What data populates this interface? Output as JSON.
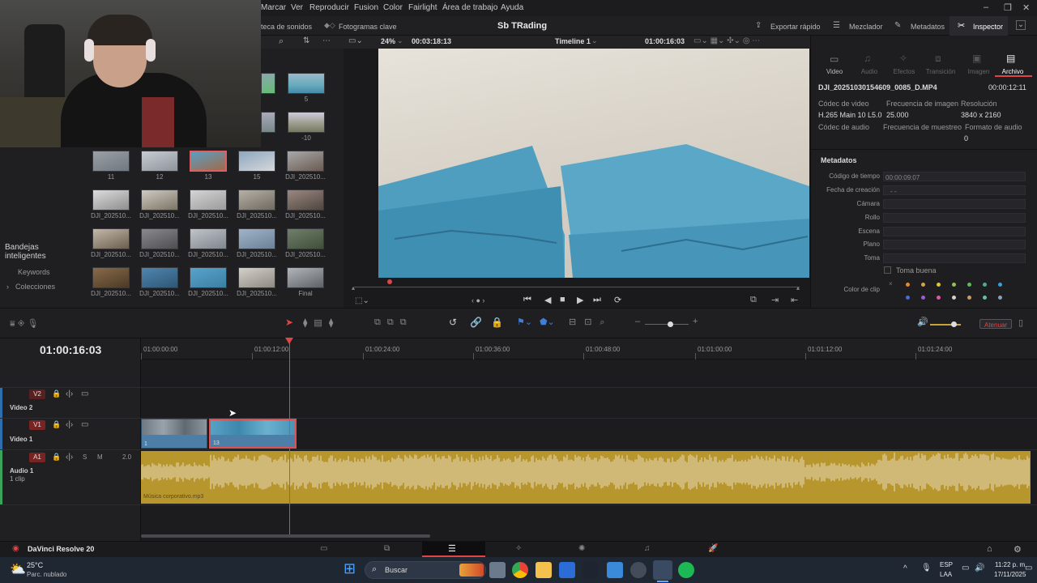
{
  "menubar": {
    "items": [
      "Marcar",
      "Ver",
      "Reproducir",
      "Fusion",
      "Color",
      "Fairlight",
      "Área de trabajo",
      "Ayuda"
    ]
  },
  "toolbar": {
    "sound_library": "teca de sonidos",
    "keyframes": "Fotogramas clave",
    "project_title": "Sb TRading",
    "quick_export": "Exportar rápido",
    "mixer": "Mezclador",
    "metadata": "Metadatos",
    "inspector": "Inspector"
  },
  "viewer": {
    "zoom": "24%",
    "timecode_left": "00:03:18:13",
    "timeline_name": "Timeline 1",
    "timecode_right": "01:00:16:03",
    "clip_number": "13"
  },
  "media_pool": {
    "partial_labels": [
      "5",
      "-10"
    ],
    "rows": [
      [
        "11",
        "12",
        "13",
        "15",
        "DJI_202510..."
      ],
      [
        "DJI_202510...",
        "DJI_202510...",
        "DJI_202510...",
        "DJI_202510...",
        "DJI_202510..."
      ],
      [
        "DJI_202510...",
        "DJI_202510...",
        "DJI_202510...",
        "DJI_202510...",
        "DJI_202510..."
      ],
      [
        "DJI_202510...",
        "DJI_202510...",
        "DJI_202510...",
        "DJI_202510...",
        "Final"
      ]
    ],
    "selected": "13",
    "bins_title": "Bandejas inteligentes",
    "bins_keywords": "Keywords",
    "bins_collections": "Colecciones"
  },
  "inspector": {
    "tabs": [
      "Video",
      "Audio",
      "Efectos",
      "Transición",
      "Imagen",
      "Archivo"
    ],
    "active_tab": "Archivo",
    "file_name": "DJI_20251030154609_0085_D.MP4",
    "duration": "00:00:12:11",
    "video_codec_label": "Códec de video",
    "frame_rate_label": "Frecuencia de imagen",
    "resolution_label": "Resolución",
    "video_codec": "H.265 Main 10 L5.0",
    "frame_rate": "25.000",
    "resolution": "3840 x 2160",
    "audio_codec_label": "Códec de audio",
    "sample_rate_label": "Frecuencia de muestreo",
    "audio_format_label": "Formato de audio",
    "audio_format": "0",
    "metadata_title": "Metadatos",
    "timecode_label": "Código de tiempo",
    "timecode": "00:00:09:07",
    "creation_date_label": "Fecha de creación",
    "creation_date": "- -",
    "camera_label": "Cámara",
    "reel_label": "Rollo",
    "scene_label": "Escena",
    "shot_label": "Plano",
    "take_label": "Toma",
    "good_take_label": "Toma buena",
    "clip_color_label": "Color de clip"
  },
  "timeline": {
    "current_timecode": "01:00:16:03",
    "ruler": [
      "01:00:00:00",
      "01:00:12:00",
      "01:00:24:00",
      "01:00:36:00",
      "01:00:48:00",
      "01:01:00:00",
      "01:01:12:00",
      "01:01:24:00"
    ],
    "attenuate": "Atenuar",
    "tracks": {
      "v2_badge": "V2",
      "v2_name": "Video 2",
      "v1_badge": "V1",
      "v1_name": "Video 1",
      "a1_badge": "A1",
      "a1_name": "Audio 1",
      "a1_clips": "1 clip",
      "a1_level": "2.0",
      "a1_solo": "S",
      "a1_mute": "M"
    },
    "clips": [
      "1",
      "13"
    ],
    "audio_clip_name": "Música corporativo.mp3"
  },
  "pagebar": {
    "app_name": "DaVinci Resolve 20"
  },
  "taskbar": {
    "weather_temp": "25°C",
    "weather_desc": "Parc. nublado",
    "search_placeholder": "Buscar",
    "lang": "ESP",
    "lang_sub": "LAA",
    "time": "11:22 p. m.",
    "date": "17/11/2025"
  },
  "colors": {
    "accent_red": "#e04545",
    "clip_blue": "#4c7ea8",
    "audio_gold": "#b8962e",
    "badge_red": "#5a2020"
  }
}
